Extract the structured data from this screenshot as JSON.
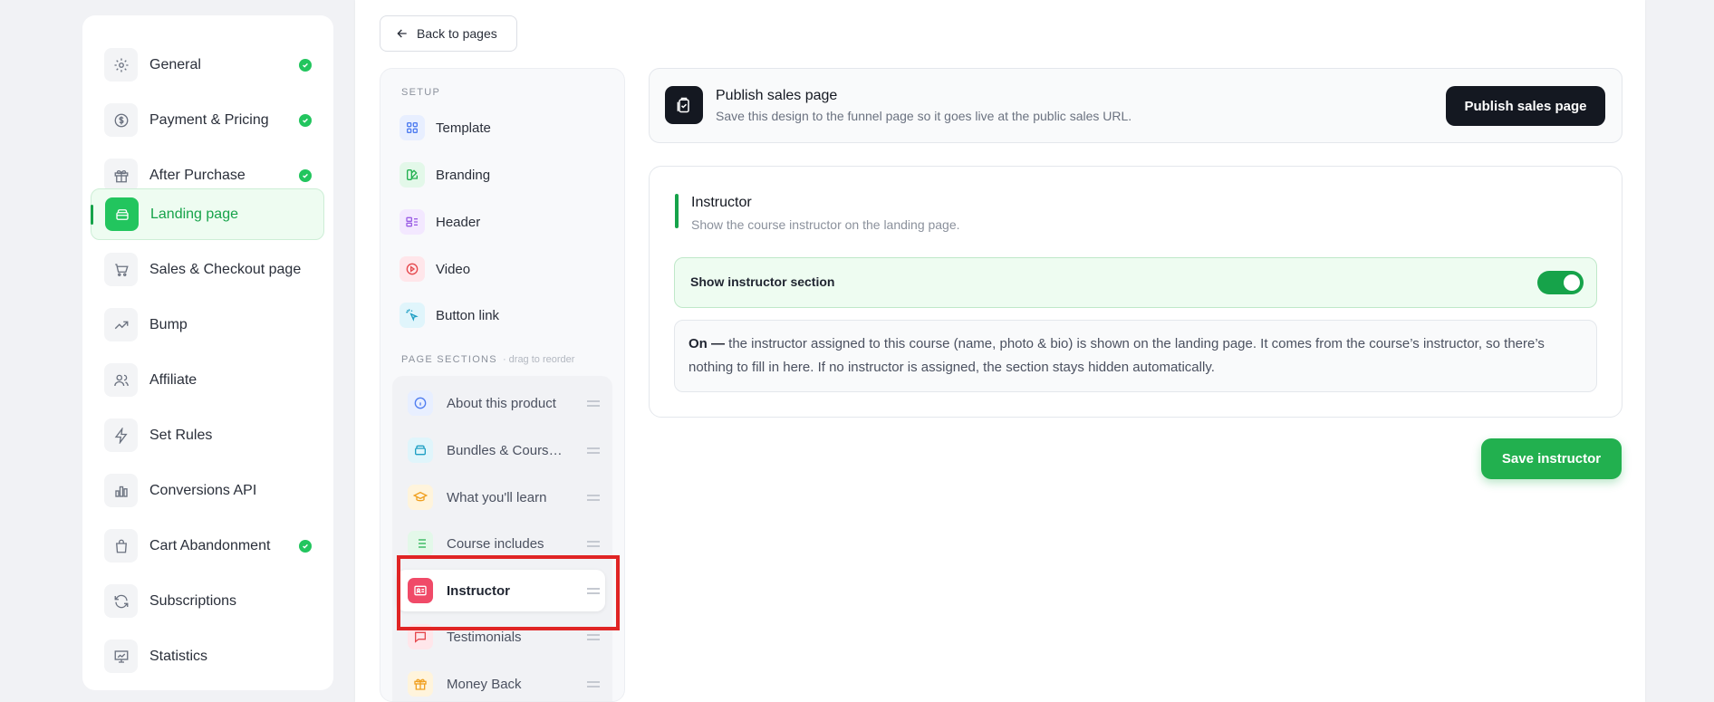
{
  "left_nav": {
    "items": [
      {
        "label": "General",
        "icon": "gear-icon",
        "done": true
      },
      {
        "label": "Payment & Pricing",
        "icon": "dollar-icon",
        "done": true
      },
      {
        "label": "After Purchase",
        "icon": "gift-icon",
        "done": true
      },
      {
        "label": "Landing page",
        "icon": "layers-icon",
        "done": false,
        "active": true
      },
      {
        "label": "Sales & Checkout page",
        "icon": "cart-icon",
        "done": false
      },
      {
        "label": "Bump",
        "icon": "trend-up-icon",
        "done": false
      },
      {
        "label": "Affiliate",
        "icon": "users-icon",
        "done": false
      },
      {
        "label": "Set Rules",
        "icon": "bolt-icon",
        "done": false
      },
      {
        "label": "Conversions API",
        "icon": "bar-chart-icon",
        "done": false
      },
      {
        "label": "Cart Abandonment",
        "icon": "bag-icon",
        "done": true
      },
      {
        "label": "Subscriptions",
        "icon": "refresh-icon",
        "done": false
      },
      {
        "label": "Statistics",
        "icon": "presentation-icon",
        "done": false
      }
    ]
  },
  "back_button": {
    "label": "Back to pages"
  },
  "section_panel": {
    "setup_heading": "SETUP",
    "setup_items": [
      {
        "label": "Template",
        "icon": "grid-icon"
      },
      {
        "label": "Branding",
        "icon": "palette-icon"
      },
      {
        "label": "Header",
        "icon": "layout-icon"
      },
      {
        "label": "Video",
        "icon": "play-icon"
      },
      {
        "label": "Button link",
        "icon": "pointer-click-icon"
      }
    ],
    "sections_heading": "PAGE SECTIONS",
    "sections_hint": "· drag to reorder",
    "sections": [
      {
        "label": "About this product",
        "icon": "info-icon"
      },
      {
        "label": "Bundles & Course...",
        "icon": "stack-icon"
      },
      {
        "label": "What you'll learn",
        "icon": "graduation-cap-icon"
      },
      {
        "label": "Course includes",
        "icon": "list-icon"
      },
      {
        "label": "Instructor",
        "icon": "id-card-icon",
        "selected": true
      },
      {
        "label": "Testimonials",
        "icon": "chat-icon"
      },
      {
        "label": "Money Back",
        "icon": "gift-icon"
      }
    ]
  },
  "publish": {
    "title": "Publish sales page",
    "subtitle": "Save this design to the funnel page so it goes live at the public sales URL.",
    "button": "Publish sales page"
  },
  "instructor": {
    "title": "Instructor",
    "subtitle": "Show the course instructor on the landing page.",
    "toggle_label": "Show instructor section",
    "toggle_on": true,
    "note_strong": "On —",
    "note_text": " the instructor assigned to this course (name, photo & bio) is shown on the landing page. It comes from the course’s instructor, so there’s nothing to fill in here. If no instructor is assigned, the section stays hidden automatically."
  },
  "save_button": "Save instructor",
  "colors": {
    "accent": "#16a34a",
    "dark": "#141821",
    "highlight": "#e02424"
  }
}
